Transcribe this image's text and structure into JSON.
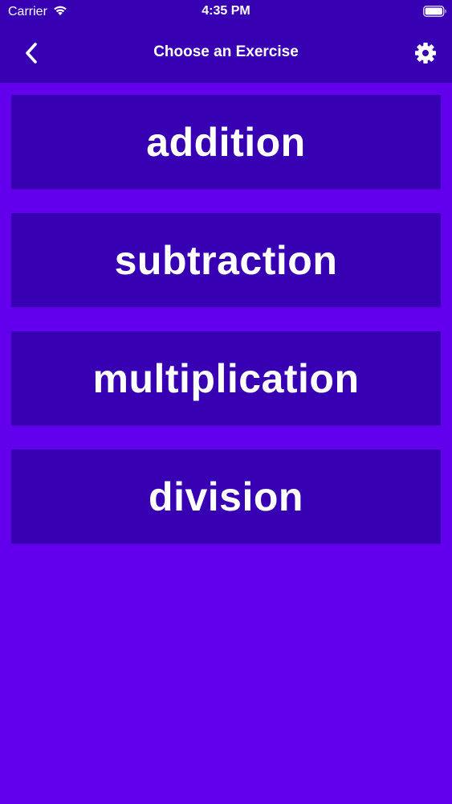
{
  "status_bar": {
    "carrier": "Carrier",
    "time": "4:35 PM",
    "wifi_icon": "wifi-icon",
    "battery_icon": "battery-icon"
  },
  "nav": {
    "title": "Choose an Exercise",
    "back_icon": "chevron-left-icon",
    "settings_icon": "gear-icon"
  },
  "exercises": [
    {
      "label": "addition"
    },
    {
      "label": "subtraction"
    },
    {
      "label": "multiplication"
    },
    {
      "label": "division"
    }
  ],
  "colors": {
    "background": "#6200ee",
    "bar": "#3700b3",
    "button": "#3700b3",
    "text": "#ffffff"
  }
}
